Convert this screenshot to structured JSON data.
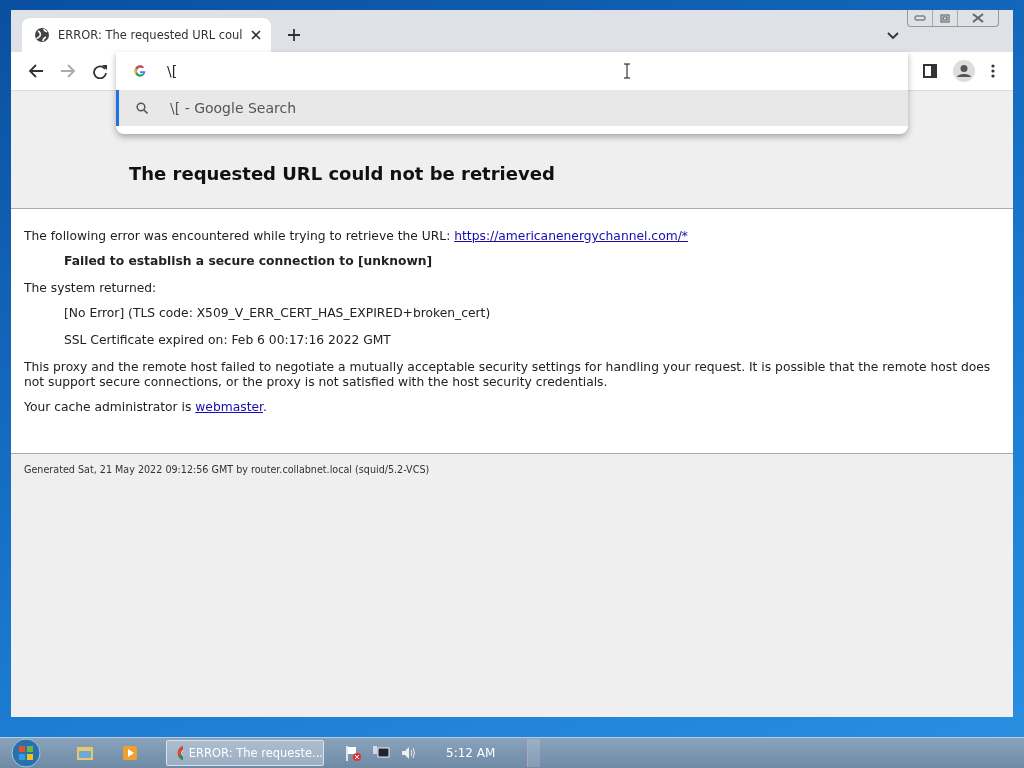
{
  "tabs": [
    {
      "title": "ERROR: The requested URL coul",
      "selected": true
    }
  ],
  "omnibox": {
    "value": "\\[",
    "suggestions": [
      {
        "text": "\\[ - Google Search",
        "selected": true
      }
    ]
  },
  "page": {
    "subtitle": "The requested URL could not be retrieved",
    "blocks": [
      {
        "kind": "para",
        "parts": [
          {
            "kind": "text",
            "text": "The following error was encountered while trying to retrieve the URL: "
          },
          {
            "kind": "link",
            "text": "https://americanenergychannel.com/*"
          }
        ]
      },
      {
        "kind": "indent-bold",
        "parts": [
          {
            "kind": "text",
            "text": "Failed to establish a secure connection to [unknown]"
          }
        ]
      },
      {
        "kind": "para",
        "parts": [
          {
            "kind": "text",
            "text": "The system returned:"
          }
        ]
      },
      {
        "kind": "indent",
        "parts": [
          {
            "kind": "text",
            "text": "[No Error] (TLS code: X509_V_ERR_CERT_HAS_EXPIRED+broken_cert)"
          }
        ]
      },
      {
        "kind": "indent",
        "parts": [
          {
            "kind": "text",
            "text": "SSL Certificate expired on: Feb 6 00:17:16 2022 GMT"
          }
        ]
      },
      {
        "kind": "para",
        "parts": [
          {
            "kind": "text",
            "text": "This proxy and the remote host failed to negotiate a mutually acceptable security settings for handling your request. It is possible that the remote host does not support secure connections, or the proxy is not satisfied with the host security credentials."
          }
        ]
      },
      {
        "kind": "para",
        "parts": [
          {
            "kind": "text",
            "text": "Your cache administrator is "
          },
          {
            "kind": "link",
            "text": "webmaster"
          },
          {
            "kind": "text",
            "text": "."
          }
        ]
      }
    ],
    "footer": "Generated Sat, 21 May 2022 09:12:56 GMT by router.collabnet.local (squid/5.2-VCS)"
  },
  "taskbar": {
    "items": [
      {
        "label": "ERROR: The requeste...",
        "selected": true
      }
    ],
    "clock": "5:12 AM"
  }
}
